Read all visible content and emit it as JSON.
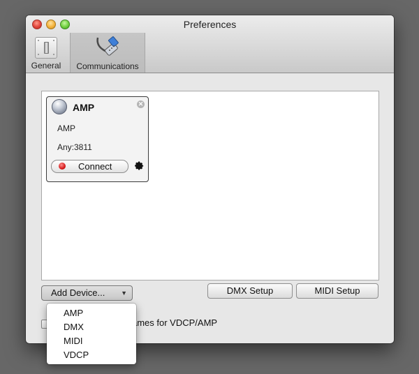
{
  "window": {
    "title": "Preferences"
  },
  "toolbar": {
    "items": [
      {
        "label": "General",
        "icon": "switch-icon"
      },
      {
        "label": "Communications",
        "icon": "cable-icon",
        "selected": true
      }
    ]
  },
  "device": {
    "name": "AMP",
    "type": "AMP",
    "address": "Any:3811",
    "connect_label": "Connect",
    "status_color": "#d51a1a"
  },
  "buttons": {
    "add_device": "Add Device...",
    "dmx_setup": "DMX Setup",
    "midi_setup": "MIDI Setup"
  },
  "checkbox": {
    "label": "Use character file names for VDCP/AMP",
    "checked": false
  },
  "menu": {
    "items": [
      "AMP",
      "DMX",
      "MIDI",
      "VDCP"
    ]
  }
}
